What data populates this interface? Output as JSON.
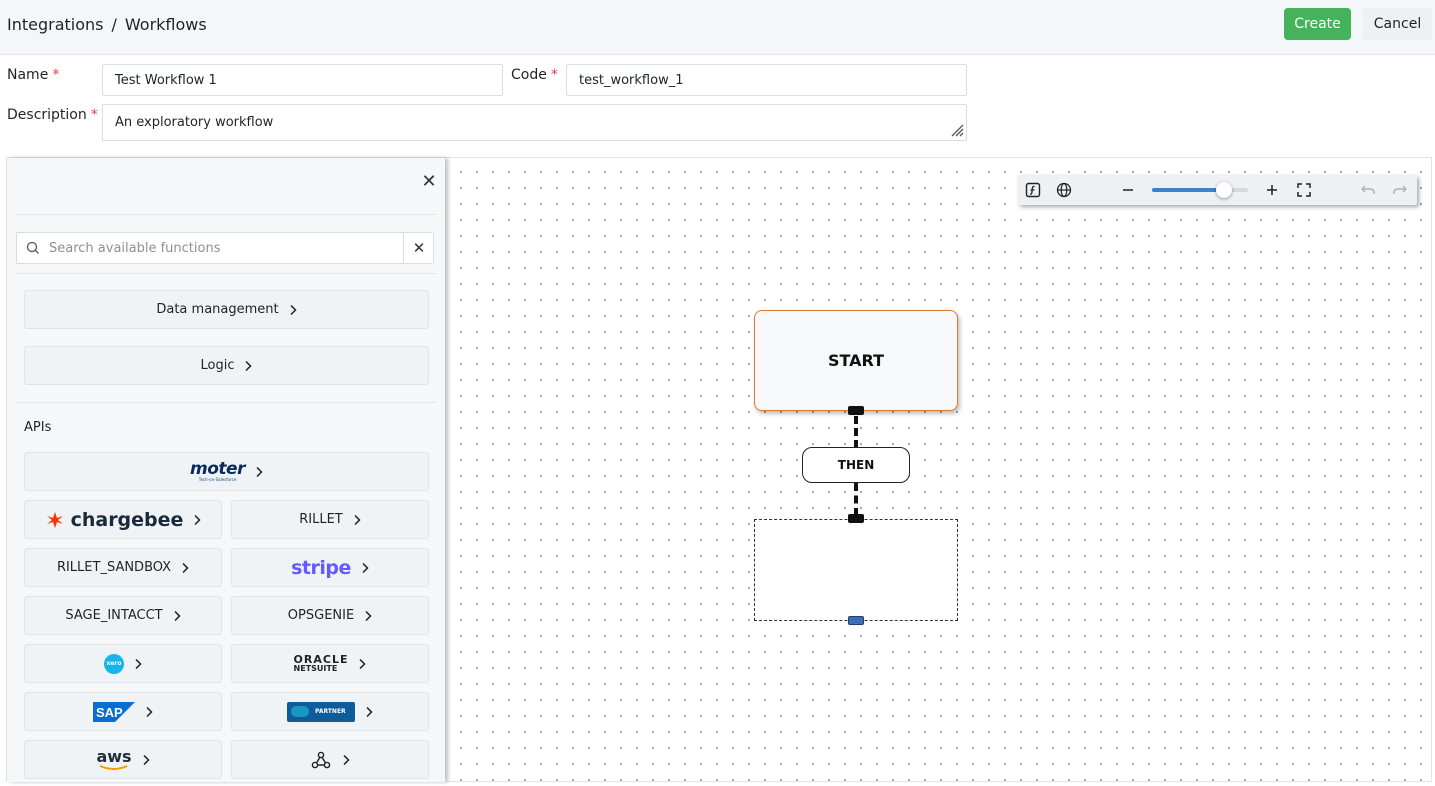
{
  "header": {
    "breadcrumb": [
      "Integrations",
      "/",
      "Workflows"
    ],
    "create_label": "Create",
    "cancel_label": "Cancel"
  },
  "form": {
    "name_label": "Name",
    "name_value": "Test Workflow 1",
    "code_label": "Code",
    "code_value": "test_workflow_1",
    "description_label": "Description",
    "description_value": "An exploratory workflow",
    "required_mark": "*"
  },
  "sidebar": {
    "search_placeholder": "Search available functions",
    "categories": [
      "Data management",
      "Logic"
    ],
    "apis_label": "APIs",
    "api_tiles": {
      "moter": "moter",
      "moter_sub": "Tech-on-Salesforce",
      "chargebee": "chargebee",
      "rillet": "RILLET",
      "rillet_sandbox": "RILLET_SANDBOX",
      "stripe": "stripe",
      "sage_intacct": "SAGE_INTACCT",
      "opsgenie": "OPSGENIE",
      "xero": "xero",
      "oracle": "ORACLE",
      "netsuite": "NETSUITE",
      "sap": "SAP",
      "salesforce_partner": "PARTNER",
      "aws": "aws"
    }
  },
  "canvas": {
    "start_label": "START",
    "then_label": "THEN",
    "zoom_percent": 75
  },
  "colors": {
    "create_green": "#44b35a",
    "start_border": "#e07a2a",
    "slider_blue": "#3c82c8",
    "stripe_purple": "#635bff",
    "chargebee_orange": "#ff3300",
    "sap_blue": "#0a6ed1",
    "salesforce_blue": "#0d5c9c",
    "xero_cyan": "#13b5ea",
    "aws_orange": "#ff9900",
    "handle_blue": "#3a6fb5"
  }
}
